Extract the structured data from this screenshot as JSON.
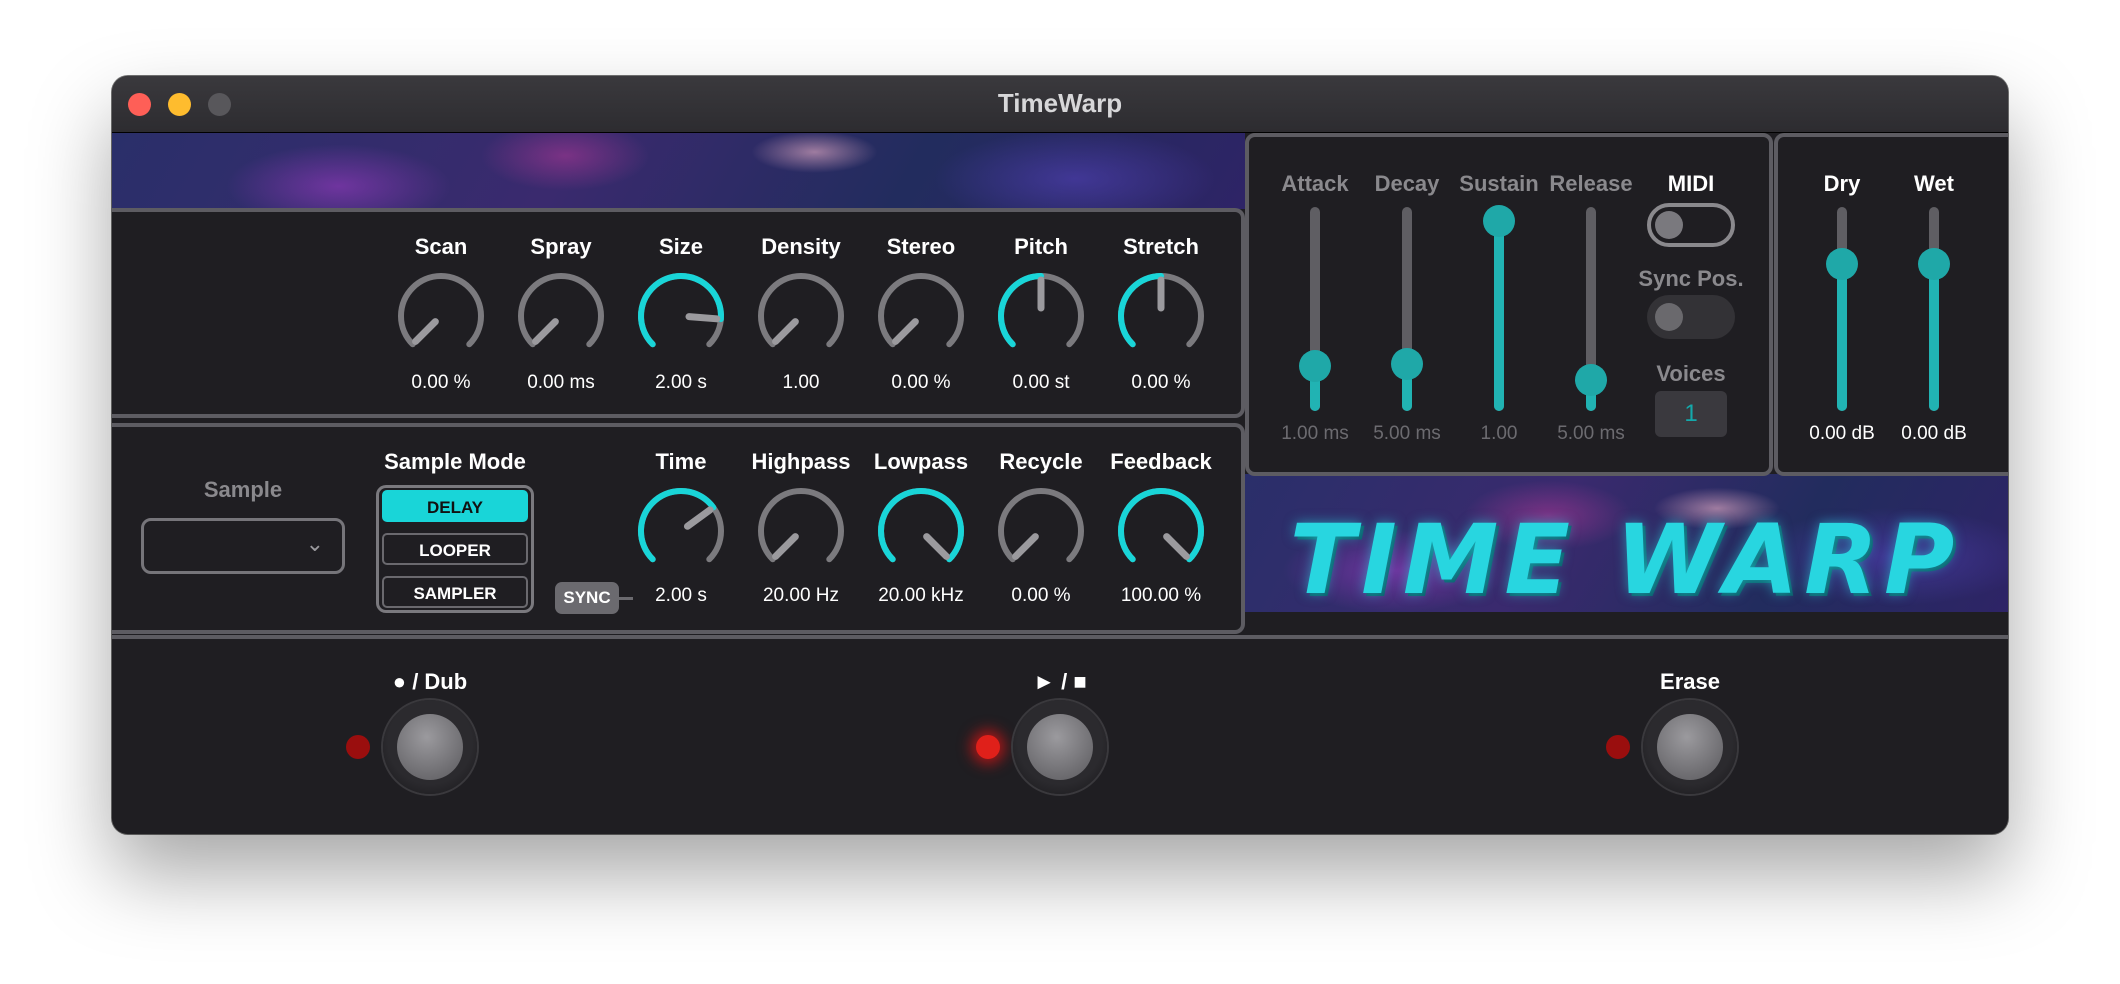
{
  "window": {
    "title": "TimeWarp"
  },
  "grain": {
    "knobs": [
      {
        "label": "Scan",
        "value": "0.00 %",
        "norm": 0.0,
        "accent": false
      },
      {
        "label": "Spray",
        "value": "0.00 ms",
        "norm": 0.0,
        "accent": false
      },
      {
        "label": "Size",
        "value": "2.00 s",
        "norm": 0.85,
        "accent": true
      },
      {
        "label": "Density",
        "value": "1.00",
        "norm": 0.0,
        "accent": false
      },
      {
        "label": "Stereo",
        "value": "0.00 %",
        "norm": 0.0,
        "accent": false
      },
      {
        "label": "Pitch",
        "value": "0.00 st",
        "norm": 0.5,
        "accent": true
      },
      {
        "label": "Stretch",
        "value": "0.00 %",
        "norm": 0.5,
        "accent": true
      }
    ]
  },
  "sample": {
    "label": "Sample",
    "value": ""
  },
  "sample_mode": {
    "label": "Sample Mode",
    "options": [
      "DELAY",
      "LOOPER",
      "SAMPLER"
    ],
    "selected": "DELAY"
  },
  "delay": {
    "sync_label": "SYNC",
    "knobs": [
      {
        "label": "Time",
        "value": "2.00 s",
        "norm": 0.7,
        "accent": true
      },
      {
        "label": "Highpass",
        "value": "20.00 Hz",
        "norm": 0.0,
        "accent": false
      },
      {
        "label": "Lowpass",
        "value": "20.00 kHz",
        "norm": 1.0,
        "accent": true
      },
      {
        "label": "Recycle",
        "value": "0.00 %",
        "norm": 0.0,
        "accent": false
      },
      {
        "label": "Feedback",
        "value": "100.00 %",
        "norm": 1.0,
        "accent": true
      }
    ]
  },
  "envelope": {
    "sliders": [
      {
        "label": "Attack",
        "value": "1.00 ms",
        "level": 0.22
      },
      {
        "label": "Decay",
        "value": "5.00 ms",
        "level": 0.23
      },
      {
        "label": "Sustain",
        "value": "1.00",
        "level": 0.93
      },
      {
        "label": "Release",
        "value": "5.00 ms",
        "level": 0.15
      }
    ],
    "midi_label": "MIDI",
    "midi_on": false,
    "sync_pos_label": "Sync Pos.",
    "sync_pos_on": false,
    "voices_label": "Voices",
    "voices_value": "1"
  },
  "mix": {
    "sliders": [
      {
        "label": "Dry",
        "value": "0.00 dB",
        "level": 0.72
      },
      {
        "label": "Wet",
        "value": "0.00 dB",
        "level": 0.72
      }
    ]
  },
  "logo": {
    "text": "TIME WARP"
  },
  "transport": {
    "buttons": [
      {
        "label": "● / Dub",
        "led_on": false
      },
      {
        "label": "► / ■",
        "led_on": true
      },
      {
        "label": "Erase",
        "led_on": false
      }
    ]
  },
  "colors": {
    "accent": "#19d5d8",
    "knob_track": "#7b7a7e",
    "panel": "#1f1e22",
    "border": "#5d5c62",
    "led": "#e0201a"
  }
}
